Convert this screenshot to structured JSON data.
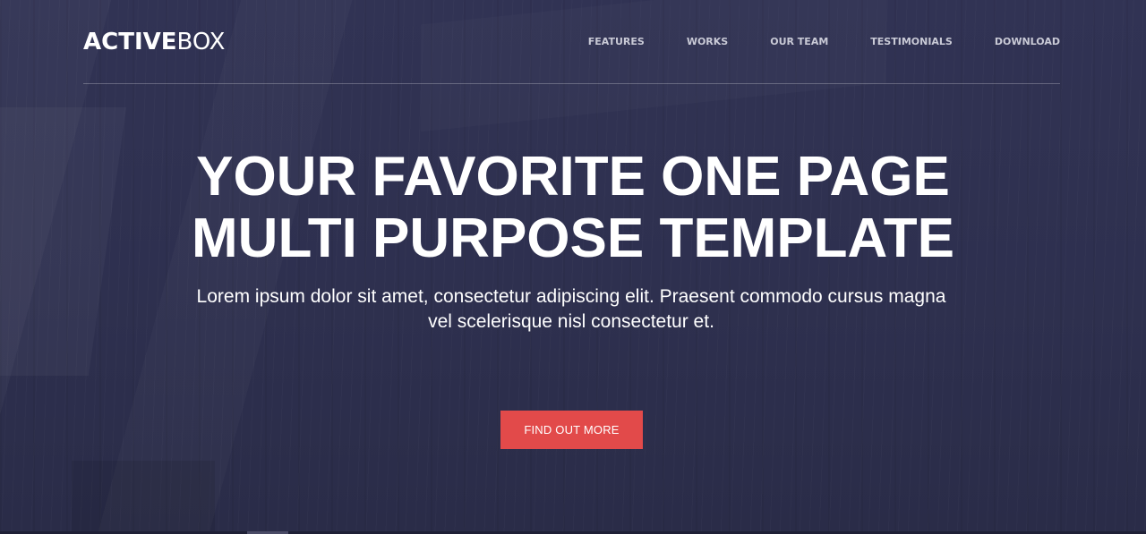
{
  "brand": {
    "logo_bold": "ACTIVE",
    "logo_light": "BOX"
  },
  "nav": {
    "items": [
      {
        "label": "FEATURES"
      },
      {
        "label": "WORKS"
      },
      {
        "label": "OUR TEAM"
      },
      {
        "label": "TESTIMONIALS"
      },
      {
        "label": "DOWNLOAD"
      }
    ]
  },
  "hero": {
    "headline_line1": "YOUR FAVORITE ONE PAGE",
    "headline_line2": "MULTI PURPOSE TEMPLATE",
    "subtitle": "Lorem ipsum dolor sit amet, consectetur adipiscing elit. Praesent commodo cursus magna vel scelerisque nisl consectetur et.",
    "cta_label": "FIND OUT MORE"
  },
  "colors": {
    "background": "#2f3150",
    "accent": "#e24a4a",
    "text": "#ffffff",
    "nav_text": "#c9cad6"
  }
}
